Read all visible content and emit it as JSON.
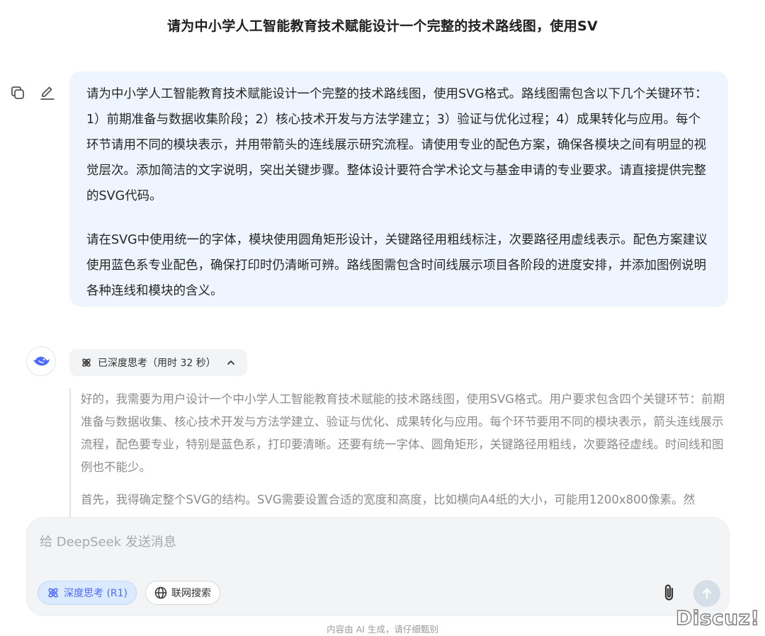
{
  "header": {
    "title": "请为中小学人工智能教育技术赋能设计一个完整的技术路线图，使用SV"
  },
  "user_message": {
    "paragraph_1": "请为中小学人工智能教育技术赋能设计一个完整的技术路线图，使用SVG格式。路线图需包含以下几个关键环节：1）前期准备与数据收集阶段；2）核心技术开发与方法学建立；3）验证与优化过程；4）成果转化与应用。每个环节请用不同的模块表示，并用带箭头的连线展示研究流程。请使用专业的配色方案，确保各模块之间有明显的视觉层次。添加简洁的文字说明，突出关键步骤。整体设计要符合学术论文与基金申请的专业要求。请直接提供完整的SVG代码。",
    "paragraph_2": "请在SVG中使用统一的字体，模块使用圆角矩形设计，关键路径用粗线标注，次要路径用虚线表示。配色方案建议使用蓝色系专业配色，确保打印时仍清晰可辨。路线图需包含时间线展示项目各阶段的进度安排，并添加图例说明各种连线和模块的含义。"
  },
  "message_actions": {
    "copy_icon": "copy-icon",
    "edit_icon": "edit-icon"
  },
  "assistant": {
    "avatar_icon": "deepseek-whale-icon",
    "thinking_chip_label": "已深度思考（用时 32 秒）",
    "thinking_paragraph_1": "好的，我需要为用户设计一个中小学人工智能教育技术赋能的技术路线图，使用SVG格式。用户要求包含四个关键环节：前期准备与数据收集、核心技术开发与方法学建立、验证与优化、成果转化与应用。每个环节要用不同的模块表示，箭头连线展示流程，配色要专业，特别是蓝色系，打印要清晰。还要有统一字体、圆角矩形，关键路径用粗线，次要路径虚线。时间线和图例也不能少。",
    "thinking_paragraph_2": "首先，我得确定整个SVG的结构。SVG需要设置合适的宽度和高度，比如横向A4纸的大小，可能用1200x800像素。然"
  },
  "composer": {
    "placeholder": "给 DeepSeek 发送消息",
    "deep_think_label": "深度思考 (R1)",
    "web_search_label": "联网搜索"
  },
  "footer": {
    "note": "内容由 AI 生成，请仔细甄别"
  },
  "watermark": {
    "text": "Discuz!"
  },
  "colors": {
    "accent": "#4d6bfe",
    "bubble_bg": "#eef5fe",
    "composer_bg": "#f3f4f6",
    "thinking_text": "#8b8b8b"
  }
}
